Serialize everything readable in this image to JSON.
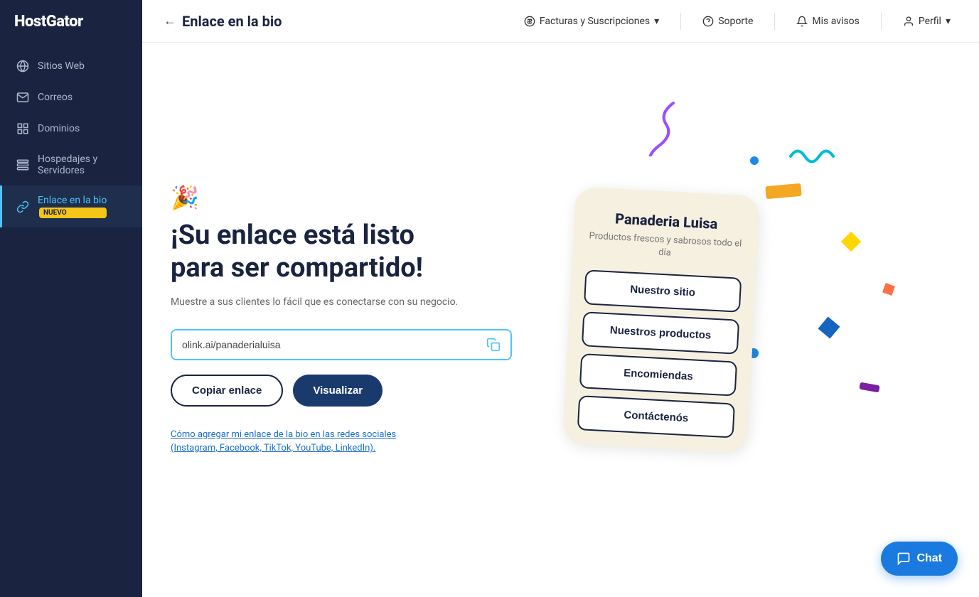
{
  "sidebar": {
    "logo": "HostGator",
    "items": [
      {
        "id": "sitios-web",
        "label": "Sitios Web",
        "icon": "globe-icon",
        "active": false
      },
      {
        "id": "correos",
        "label": "Correos",
        "icon": "mail-icon",
        "active": false
      },
      {
        "id": "dominios",
        "label": "Dominios",
        "icon": "grid-icon",
        "active": false
      },
      {
        "id": "hospedajes",
        "label": "Hospedajes y Servidores",
        "icon": "server-icon",
        "active": false
      },
      {
        "id": "enlace-bio",
        "label": "Enlace en la bio",
        "icon": "link-icon",
        "active": true,
        "badge": "NUEVO"
      }
    ]
  },
  "topnav": {
    "back_arrow": "←",
    "title": "Enlace en la bio",
    "billing_label": "Facturas y Suscripciones",
    "support_label": "Soporte",
    "notices_label": "Mis avisos",
    "profile_label": "Perfil"
  },
  "main": {
    "emoji": "🎉",
    "title_line1": "¡Su enlace está listo",
    "title_line2": "para ser compartido!",
    "subtitle": "Muestre a sus clientes lo fácil que es conectarse con su negocio.",
    "link_value": "olink.ai/panaderialuisa",
    "copy_link_label": "Copiar enlace",
    "visualize_label": "Visualizar",
    "help_link": "Cómo agregar mi enlace de la bio en las redes sociales (Instagram, Facebook, TikTok, YouTube, LinkedIn)."
  },
  "phone": {
    "title": "Panaderia Luisa",
    "subtitle": "Productos frescos y sabrosos todo el día",
    "buttons": [
      "Nuestro sitio",
      "Nuestros productos",
      "Encomiendas",
      "Contáctenós"
    ]
  },
  "chat": {
    "label": "Chat",
    "icon": "chat-icon"
  },
  "colors": {
    "sidebar_bg": "#1a2340",
    "active_color": "#4fc3f7",
    "primary_btn": "#1a3a6e",
    "link_color": "#1a6fcc",
    "chat_btn": "#1a7ae0"
  }
}
